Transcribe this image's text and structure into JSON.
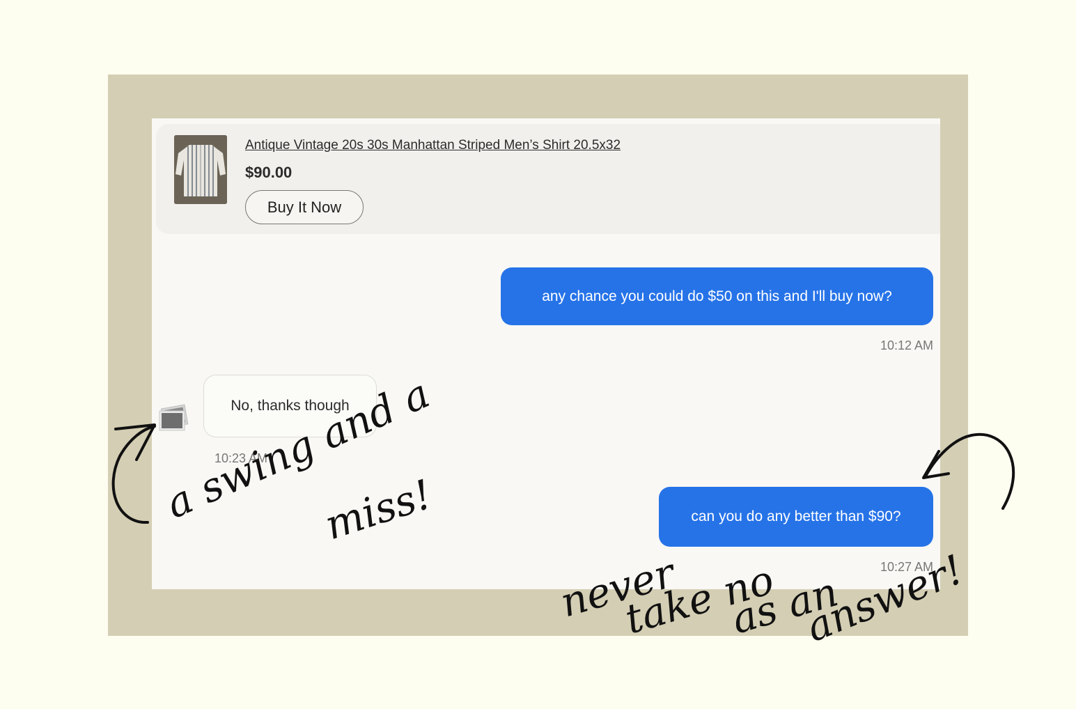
{
  "listing": {
    "title": "Antique Vintage 20s 30s Manhattan Striped Men’s Shirt 20.5x32",
    "price": "$90.00",
    "buy_label": "Buy It Now"
  },
  "messages": [
    {
      "from": "buyer",
      "text": "any chance you could do $50 on this and I'll buy now?",
      "time": "10:12 AM"
    },
    {
      "from": "seller",
      "text": "No, thanks though",
      "time": "10:23 AM"
    },
    {
      "from": "buyer",
      "text": "can you do any better than $90?",
      "time": "10:27 AM"
    }
  ],
  "annotations": {
    "left": [
      "a swing and a",
      "miss!"
    ],
    "right": [
      "never",
      "take no",
      "as an",
      "answer!"
    ]
  },
  "colors": {
    "page_bg": "#fdfdf0",
    "frame": "#d4ceb4",
    "chat_bg": "#f9f8f5",
    "outgoing_bubble": "#2673e8",
    "ink": "#111111"
  }
}
